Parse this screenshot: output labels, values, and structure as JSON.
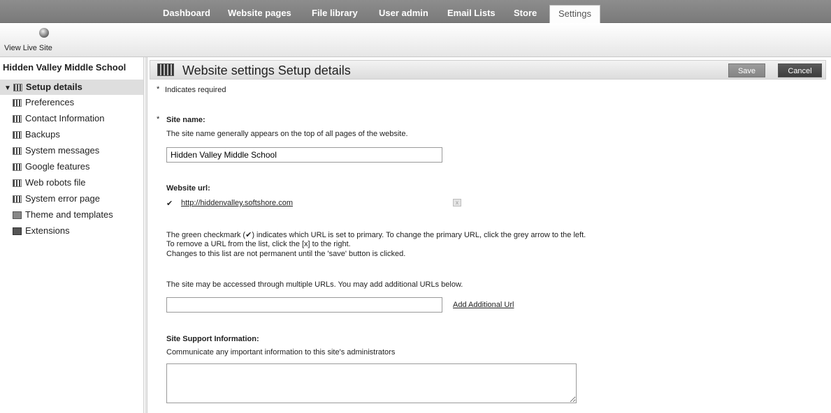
{
  "nav": {
    "tabs": [
      {
        "label": "Dashboard"
      },
      {
        "label": "Website pages"
      },
      {
        "label": "File library"
      },
      {
        "label": "User admin"
      },
      {
        "label": "Email Lists"
      },
      {
        "label": "Store"
      },
      {
        "label": "Settings"
      }
    ],
    "active_tab": "Settings"
  },
  "toolbar": {
    "view_live_label": "View Live Site"
  },
  "sidebar": {
    "title": "Hidden Valley Middle School",
    "items": [
      {
        "label": "Setup details"
      },
      {
        "label": "Preferences"
      },
      {
        "label": "Contact Information"
      },
      {
        "label": "Backups"
      },
      {
        "label": "System messages"
      },
      {
        "label": "Google features"
      },
      {
        "label": "Web robots file"
      },
      {
        "label": "System error page"
      },
      {
        "label": "Theme and templates"
      },
      {
        "label": "Extensions"
      }
    ]
  },
  "header": {
    "title": "Website settings Setup details",
    "save_label": "Save",
    "cancel_label": "Cancel"
  },
  "form": {
    "required_note": "Indicates required",
    "asterisk": "*",
    "site_name": {
      "label": "Site name:",
      "help": "The site name generally appears on the top of all pages of the website.",
      "value": "Hidden Valley Middle School"
    },
    "website_url": {
      "label": "Website url:",
      "checkmark": "✔",
      "url": "http://hiddenvalley.softshore.com",
      "remove_label": "x",
      "info_line1": "The green checkmark (✔) indicates which URL is set to primary. To change the primary URL, click the grey arrow to the left.",
      "info_line2": "To remove a URL from the list, click the [x] to the right.",
      "info_line3": "Changes to this list are not permanent until the 'save' button is clicked.",
      "multi_note": "The site may be accessed through multiple URLs. You may add additional URLs below.",
      "add_value": "",
      "add_link": "Add Additional Url"
    },
    "support": {
      "label": "Site Support Information:",
      "help": "Communicate any important information to this site's administrators",
      "value": ""
    }
  }
}
